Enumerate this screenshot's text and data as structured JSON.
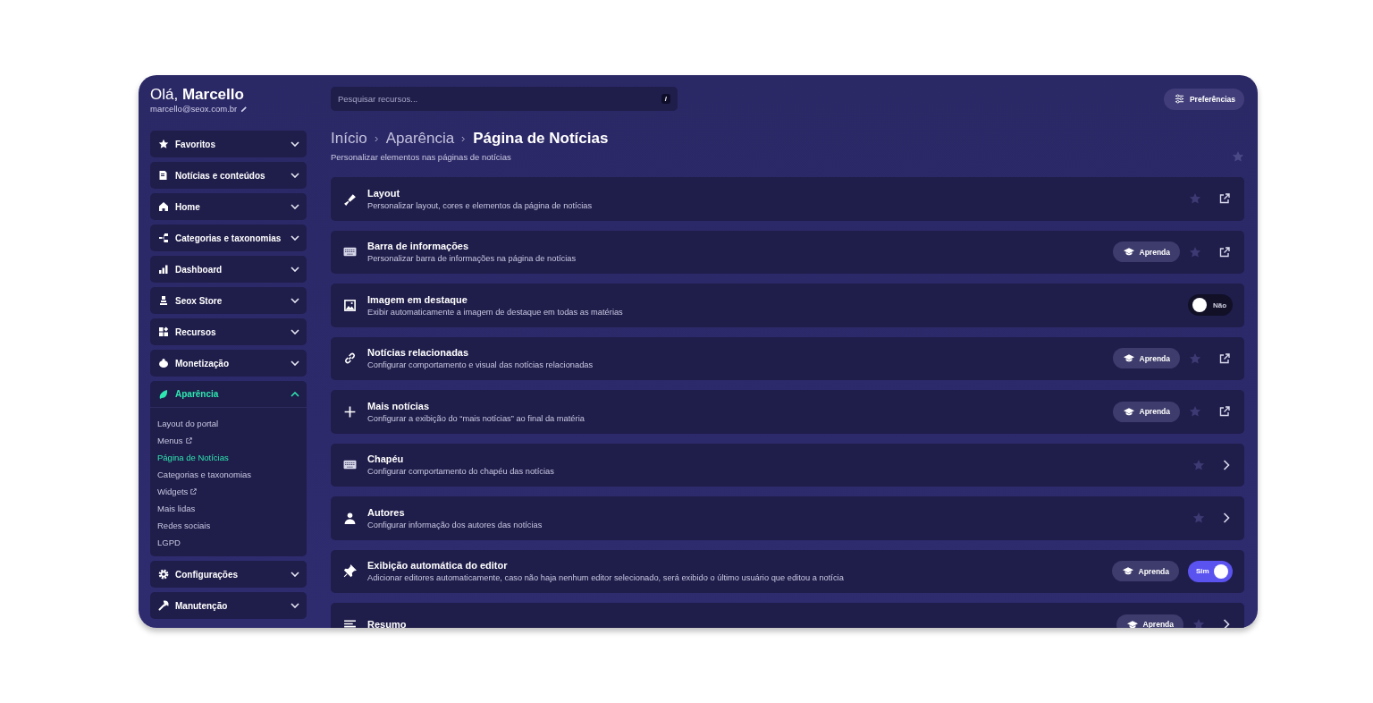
{
  "user": {
    "greeting": "Olá,",
    "name": "Marcello",
    "email": "marcello@seox.com.br"
  },
  "sidebar": {
    "items": [
      {
        "label": "Favoritos",
        "expanded": false
      },
      {
        "label": "Notícias e conteúdos",
        "expanded": false
      },
      {
        "label": "Home",
        "expanded": false
      },
      {
        "label": "Categorias e taxonomias",
        "expanded": false
      },
      {
        "label": "Dashboard",
        "expanded": false
      },
      {
        "label": "Seox Store",
        "expanded": false
      },
      {
        "label": "Recursos",
        "expanded": false
      },
      {
        "label": "Monetização",
        "expanded": false
      },
      {
        "label": "Aparência",
        "expanded": true,
        "children": [
          {
            "label": "Layout do portal",
            "selected": false,
            "external": false
          },
          {
            "label": "Menus",
            "selected": false,
            "external": true
          },
          {
            "label": "Página de Notícias",
            "selected": true,
            "external": false
          },
          {
            "label": "Categorias e taxonomias",
            "selected": false,
            "external": false
          },
          {
            "label": "Widgets",
            "selected": false,
            "external": true
          },
          {
            "label": "Mais lidas",
            "selected": false,
            "external": false
          },
          {
            "label": "Redes sociais",
            "selected": false,
            "external": false
          },
          {
            "label": "LGPD",
            "selected": false,
            "external": false
          }
        ]
      },
      {
        "label": "Configurações",
        "expanded": false
      },
      {
        "label": "Manutenção",
        "expanded": false
      }
    ]
  },
  "search": {
    "placeholder": "Pesquisar recursos...",
    "shortcut": "/"
  },
  "preferences_button": "Preferências",
  "breadcrumb": [
    "Início",
    "Aparência",
    "Página de Notícias"
  ],
  "subtitle": "Personalizar elementos nas páginas de notícias",
  "rows": [
    {
      "title": "Layout",
      "description": "Personalizar layout, cores e elementos da página de notícias",
      "learn": null,
      "kind": "link"
    },
    {
      "title": "Barra de informações",
      "description": "Personalizar barra de informações na página de notícias",
      "learn": "Aprenda",
      "kind": "link"
    },
    {
      "title": "Imagem em destaque",
      "description": "Exibir automaticamente a imagem de destaque em todas as matérias",
      "learn": null,
      "kind": "toggle",
      "on": false,
      "toggle_label": "Não"
    },
    {
      "title": "Notícias relacionadas",
      "description": "Configurar comportamento e visual das notícias relacionadas",
      "learn": "Aprenda",
      "kind": "link"
    },
    {
      "title": "Mais notícias",
      "description": "Configurar a exibição do “mais notícias” ao final da matéria",
      "learn": "Aprenda",
      "kind": "link"
    },
    {
      "title": "Chapéu",
      "description": "Configurar comportamento do chapéu das notícias",
      "learn": null,
      "kind": "chevron"
    },
    {
      "title": "Autores",
      "description": "Configurar informação dos autores das notícias",
      "learn": null,
      "kind": "chevron"
    },
    {
      "title": "Exibição automática do editor",
      "description": "Adicionar editores automaticamente, caso não haja nenhum editor selecionado, será exibido o último usuário que editou a notícia",
      "learn": "Aprenda",
      "kind": "toggle",
      "on": true,
      "toggle_label": "Sim"
    },
    {
      "title": "Resumo",
      "learn": "Aprenda",
      "kind": "chevron"
    }
  ]
}
